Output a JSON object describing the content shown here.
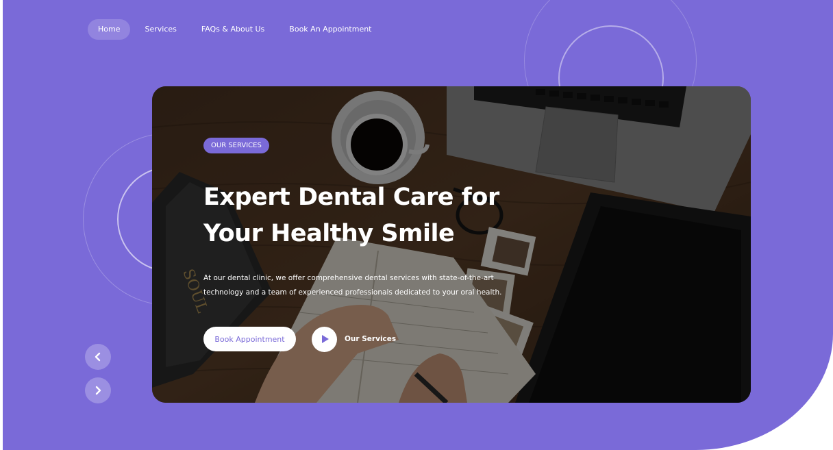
{
  "nav": {
    "items": [
      {
        "label": "Home",
        "active": true
      },
      {
        "label": "Services",
        "active": false
      },
      {
        "label": "FAQs & About Us",
        "active": false
      },
      {
        "label": "Book An Appointment",
        "active": false
      }
    ]
  },
  "hero": {
    "badge": "OUR SERVICES",
    "title_line1": "Expert Dental Care for",
    "title_line2": "Your Healthy Smile",
    "description": "At our dental clinic, we offer comprehensive dental services with state-of-the-art technology and a team of experienced professionals dedicated to your oral health.",
    "book_button": "Book Appointment",
    "services_link": "Our Services",
    "image_alt": "Desk with coffee cup, laptop, tablet, photos and a person writing in a notebook"
  },
  "carousel": {
    "prev_icon": "chevron-left-icon",
    "next_icon": "chevron-right-icon"
  },
  "colors": {
    "accent": "#7a6ad8",
    "background": "#ffffff",
    "text_on_accent": "#ffffff"
  }
}
